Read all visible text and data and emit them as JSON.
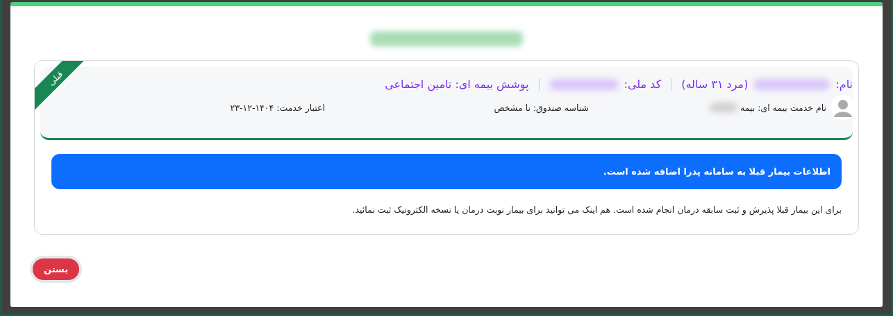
{
  "modal": {
    "ribbon": "قبلی",
    "patient": {
      "name_label": "نام:",
      "age_gender": "(مرد ۳۱ ساله)",
      "national_code_label": "کد ملی:",
      "coverage": "پوشش بیمه ای: تامین اجتماعی"
    },
    "details": [
      {
        "kind": "service",
        "text": "نام خدمت بیمه ای: بیمه"
      },
      {
        "kind": "plain",
        "text": "شناسه صندوق: نا مشخص"
      },
      {
        "kind": "plain",
        "text": "اعتبار خدمت: ۱۴۰۴-۱۲-۲۳"
      }
    ],
    "alert": "اطلاعات بیمار قبلا به سامانه پدرا اضافه شده است.",
    "message": "برای این بیمار قبلا پذیرش و ثبت سابقه درمان انجام شده است. هم اینک می توانید برای بیمار نوبت درمان یا نسخه الکترونیک ثبت نمائید.",
    "close_button": "بستن"
  }
}
